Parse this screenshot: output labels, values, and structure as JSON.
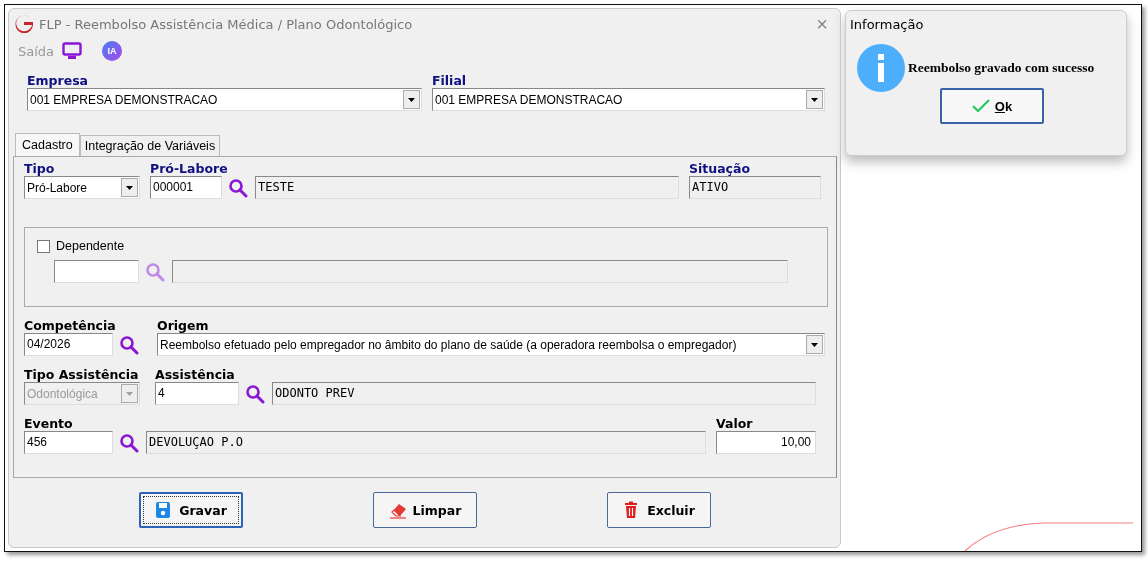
{
  "window": {
    "title": "FLP - Reembolso Assistência Médica / Plano Odontológico",
    "close": "×"
  },
  "toolbar": {
    "label": "Saída",
    "badge": "IA"
  },
  "empresa": {
    "label": "Empresa",
    "required": true,
    "value": "001 EMPRESA DEMONSTRACAO"
  },
  "filial": {
    "label": "Filial",
    "required": true,
    "value": "001 EMPRESA DEMONSTRACAO"
  },
  "tabs": [
    {
      "label": "Cadastro",
      "selected": true
    },
    {
      "label": "Integração de Variáveis",
      "selected": false
    }
  ],
  "tipo": {
    "label": "Tipo",
    "required": true,
    "value": "Pró-Labore"
  },
  "pro_labore": {
    "label": "Pró-Labore",
    "required": true,
    "code": "000001",
    "name": "TESTE"
  },
  "situacao": {
    "label": "Situação",
    "required": true,
    "value": "ATIVO"
  },
  "dependente": {
    "label": "Dependente",
    "checked": false
  },
  "competencia": {
    "label": "Competência",
    "required": false,
    "value": "04/2026"
  },
  "origem": {
    "label": "Origem",
    "required": false,
    "value": "Reembolso efetuado pelo empregador no âmbito do plano de saúde (a operadora reembolsa o empregador)"
  },
  "tipo_assistencia": {
    "label": "Tipo Assistência",
    "required": false,
    "value": "Odontológica",
    "disabled": true
  },
  "assistencia": {
    "label": "Assistência",
    "required": false,
    "code": "4",
    "name": "ODONTO PREV"
  },
  "evento": {
    "label": "Evento",
    "required": false,
    "code": "456",
    "name": "DEVOLUÇAO P.O"
  },
  "valor": {
    "label": "Valor",
    "required": false,
    "value": "10,00"
  },
  "buttons": [
    {
      "label": "Gravar",
      "kind": "save",
      "focused": true
    },
    {
      "label": "Limpar",
      "kind": "clear",
      "focused": false
    },
    {
      "label": "Excluir",
      "kind": "delete",
      "focused": false
    }
  ],
  "dialog": {
    "title": "Informação",
    "message": "Reembolso gravado com sucesso",
    "button": "Ok"
  }
}
